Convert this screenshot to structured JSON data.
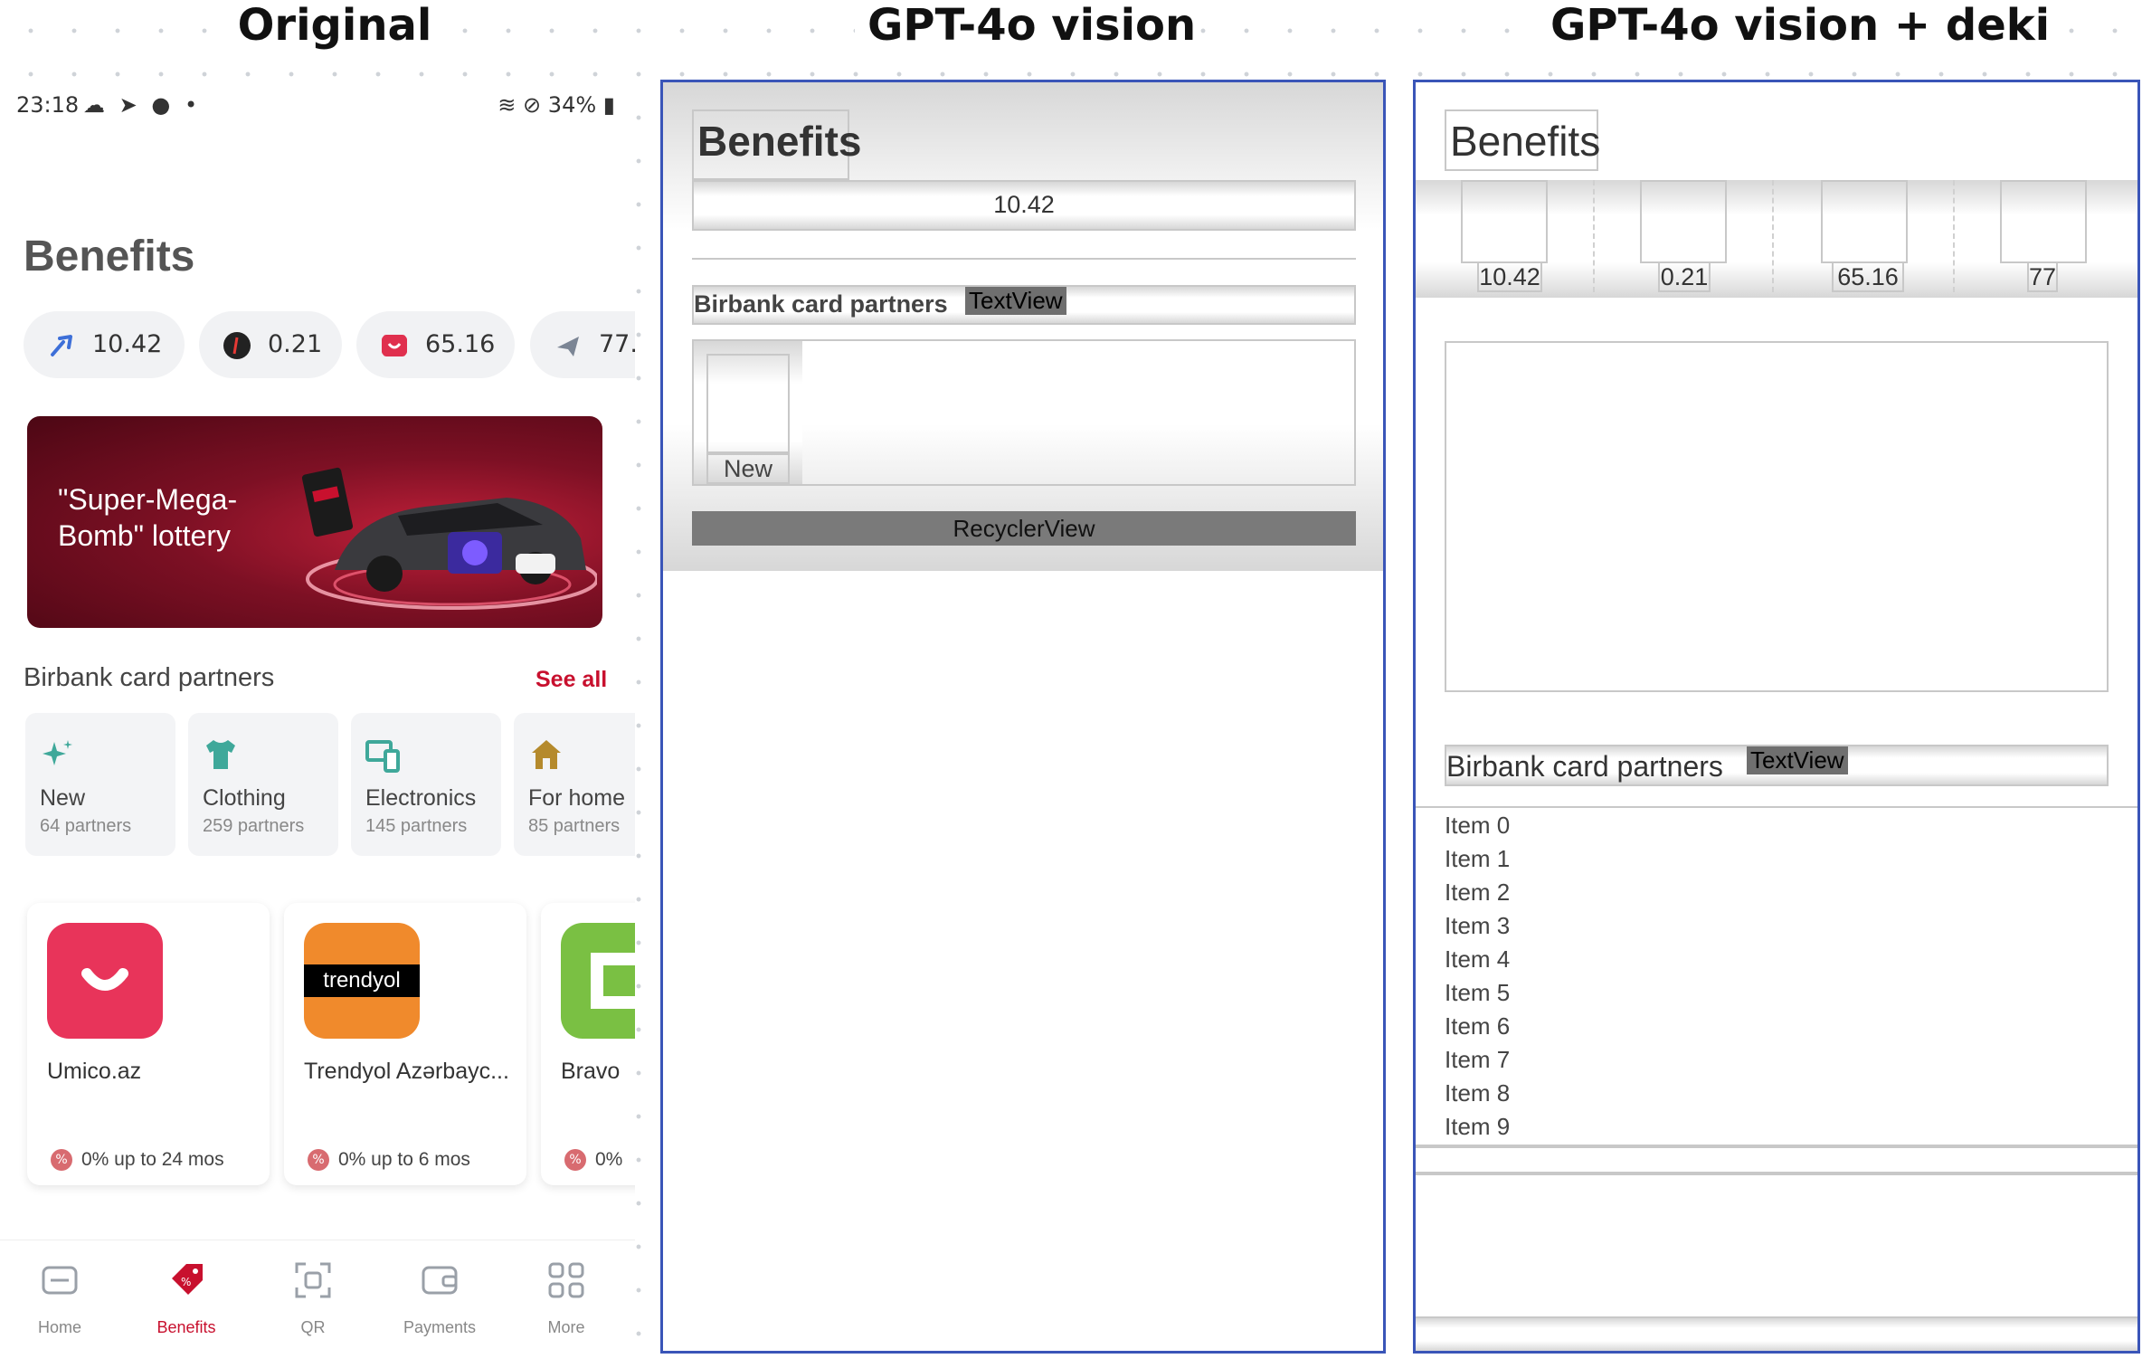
{
  "headings": {
    "original": "Original",
    "gpt": "GPT-4o vision",
    "gpt_deki": "GPT-4o vision + deki"
  },
  "original": {
    "status": {
      "time": "23:18",
      "battery": "34%"
    },
    "title": "Benefits",
    "chips": [
      {
        "value": "10.42",
        "icon": "cashback-icon",
        "color": "#3d6fd8"
      },
      {
        "value": "0.21",
        "icon": "bonus-coin-icon",
        "color": "#222222"
      },
      {
        "value": "65.16",
        "icon": "umico-icon",
        "color": "#e0304e"
      },
      {
        "value": "77.",
        "icon": "plane-icon",
        "color": "#7b8594"
      }
    ],
    "banner": {
      "text": "\"Super-Mega-Bomb\" lottery"
    },
    "partners_section": {
      "title": "Birbank card partners",
      "see_all": "See all"
    },
    "categories": [
      {
        "name": "New",
        "count": "64 partners",
        "icon": "sparkle-icon",
        "color": "#3fa89a"
      },
      {
        "name": "Clothing",
        "count": "259 partners",
        "icon": "tshirt-icon",
        "color": "#3fa89a"
      },
      {
        "name": "Electronics",
        "count": "145 partners",
        "icon": "devices-icon",
        "color": "#3fa89a"
      },
      {
        "name": "For home",
        "count": "85 partners",
        "icon": "house-icon",
        "color": "#b58a2c"
      }
    ],
    "partners": [
      {
        "name": "Umico.az",
        "term": "0% up to 24 mos",
        "logo": "umico-logo",
        "color": "#e8345a"
      },
      {
        "name": "Trendyol Azərbayc...",
        "term": "0% up to 6 mos",
        "logo": "trendyol-logo",
        "logo_text": "trendyol",
        "color": "#f08a2c"
      },
      {
        "name": "Bravo",
        "term": "0%",
        "logo": "bravo-logo",
        "color": "#7ac043"
      }
    ],
    "nav": [
      {
        "label": "Home",
        "icon": "home-icon",
        "active": false
      },
      {
        "label": "Benefits",
        "icon": "benefits-tag-icon",
        "active": true
      },
      {
        "label": "QR",
        "icon": "qr-scan-icon",
        "active": false
      },
      {
        "label": "Payments",
        "icon": "wallet-icon",
        "active": false
      },
      {
        "label": "More",
        "icon": "grid-icon",
        "active": false
      }
    ],
    "accent": "#c8102e"
  },
  "gpt": {
    "title": "Benefits",
    "value": "10.42",
    "section": "Birbank card partners",
    "textview": "TextView",
    "item_label": "New",
    "recycler": "RecyclerView"
  },
  "gpt_deki": {
    "title": "Benefits",
    "values": [
      "10.42",
      "0.21",
      "65.16",
      "77"
    ],
    "section": "Birbank card partners",
    "textview": "TextView",
    "items": [
      "Item 0",
      "Item 1",
      "Item 2",
      "Item 3",
      "Item 4",
      "Item 5",
      "Item 6",
      "Item 7",
      "Item 8",
      "Item 9"
    ]
  }
}
